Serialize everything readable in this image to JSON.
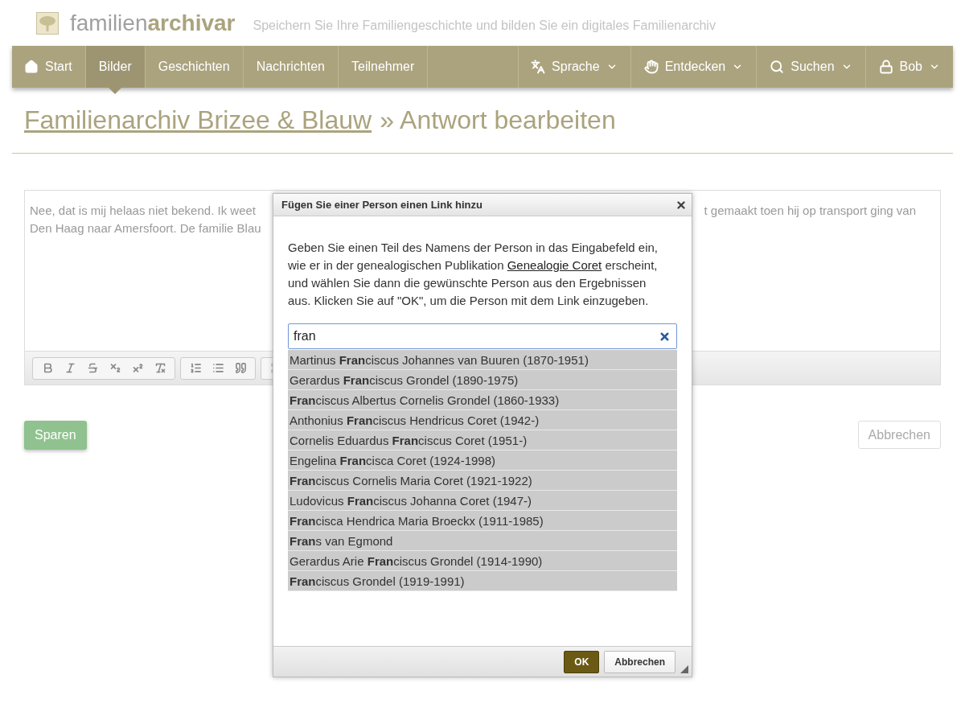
{
  "header": {
    "logo_light": "familien",
    "logo_bold": "archivar",
    "tagline": "Speichern Sie Ihre Familiengeschichte und bilden Sie ein digitales Familienarchiv"
  },
  "nav": {
    "left": [
      {
        "label": "Start",
        "selected": false
      },
      {
        "label": "Bilder",
        "selected": true
      },
      {
        "label": "Geschichten",
        "selected": false
      },
      {
        "label": "Nachrichten",
        "selected": false
      },
      {
        "label": "Teilnehmer",
        "selected": false
      }
    ],
    "right": [
      {
        "label": "Sprache"
      },
      {
        "label": "Entdecken"
      },
      {
        "label": "Suchen"
      },
      {
        "label": "Bob"
      }
    ]
  },
  "heading": {
    "link": "Familienarchiv Brizee & Blauw",
    "rest": "» Antwort bearbeiten"
  },
  "editor": {
    "left_lines": [
      "Nee, dat is mij helaas niet bekend. Ik weet",
      "Den Haag naar Amersfoort. De familie Blau"
    ],
    "right_line": "t gemaakt toen hij op transport ging van"
  },
  "actions": {
    "save": "Sparen",
    "cancel": "Abbrechen"
  },
  "dialog": {
    "title": "Fügen Sie einer Person einen Link hinzu",
    "text_before": "Geben Sie einen Teil des Namens der Person in das Eingabefeld ein, wie er in der genealogischen Publikation ",
    "link": "Genealogie Coret",
    "text_after": " erscheint, und wählen Sie dann die gewünschte Person aus den Ergebnissen aus. Klicken Sie auf \"OK\", um die Person mit dem Link einzugeben.",
    "search_value": "fran",
    "results": [
      "Martinus **Fran**ciscus Johannes van Buuren (1870-1951)",
      "Gerardus **Fran**ciscus Grondel (1890-1975)",
      "**Fran**ciscus Albertus Cornelis Grondel (1860-1933)",
      "Anthonius **Fran**ciscus Hendricus Coret (1942-)",
      "Cornelis Eduardus **Fran**ciscus Coret (1951-)",
      "Engelina **Fran**cisca Coret (1924-1998)",
      "**Fran**ciscus Cornelis Maria Coret (1921-1922)",
      "Ludovicus **Fran**ciscus Johanna Coret (1947-)",
      "**Fran**cisca Hendrica Maria Broeckx (1911-1985)",
      "**Fran**s van Egmond",
      "Gerardus Arie **Fran**ciscus Grondel (1914-1990)",
      "**Fran**ciscus Grondel (1919-1991)"
    ],
    "ok": "OK",
    "cancel": "Abbrechen"
  }
}
